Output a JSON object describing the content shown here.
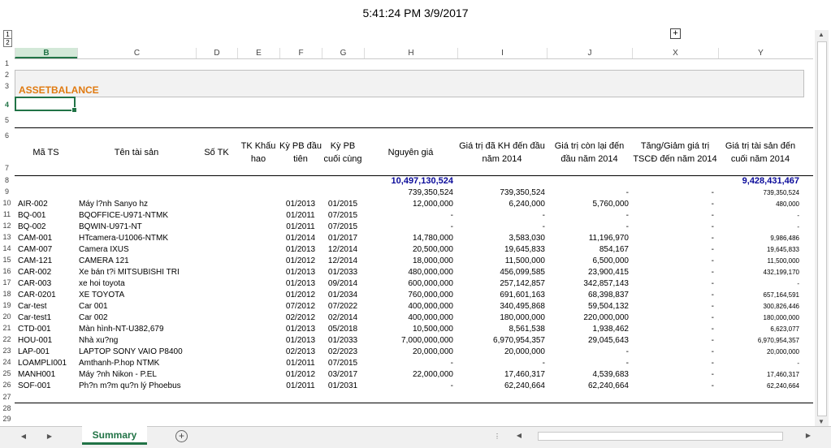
{
  "timestamp": "5:41:24 PM 3/9/2017",
  "outline": [
    "1",
    "2"
  ],
  "columns": [
    "B",
    "C",
    "D",
    "E",
    "F",
    "G",
    "H",
    "I",
    "J",
    "X",
    "Y"
  ],
  "rows": [
    "1",
    "2",
    "3",
    "4",
    "5",
    "6",
    "7",
    "8",
    "9",
    "10",
    "11",
    "12",
    "13",
    "14",
    "15",
    "16",
    "17",
    "18",
    "19",
    "20",
    "21",
    "22",
    "23",
    "24",
    "25",
    "26",
    "27",
    "28",
    "29"
  ],
  "title": "ASSETBALANCE",
  "headers": [
    "Mã TS",
    "Tên tài sản",
    "Số TK",
    "TK Khấu hao",
    "Kỳ PB đầu tiên",
    "Kỳ PB cuối cùng",
    "Nguyên giá",
    "Giá trị đã KH đến đầu năm 2014",
    "Giá trị còn lại đến đầu năm 2014",
    "Tăng/Giảm giá trị TSCĐ đến năm 2014",
    "Giá trị tài sản đến cuối năm 2014"
  ],
  "totals": {
    "nguyen_gia": "10,497,130,524",
    "cuoi_nam": "9,428,431,467"
  },
  "row9": {
    "nguyen_gia": "739,350,524",
    "da_kh": "739,350,524",
    "con_lai": "-",
    "tang_giam": "-",
    "cuoi_nam": "739,350,524"
  },
  "data": [
    {
      "ma": "AIR-002",
      "ten": "Máy l?nh Sanyo hz",
      "pb1": "01/2013",
      "pb2": "01/2015",
      "ng": "12,000,000",
      "kh": "6,240,000",
      "cl": "5,760,000",
      "tg": "-",
      "cn": "480,000"
    },
    {
      "ma": "BQ-001",
      "ten": "BQOFFICE-U971-NTMK",
      "pb1": "01/2011",
      "pb2": "07/2015",
      "ng": "-",
      "kh": "-",
      "cl": "-",
      "tg": "-",
      "cn": "-"
    },
    {
      "ma": "BQ-002",
      "ten": "BQWIN-U971-NT",
      "pb1": "01/2011",
      "pb2": "07/2015",
      "ng": "-",
      "kh": "-",
      "cl": "-",
      "tg": "-",
      "cn": "-"
    },
    {
      "ma": "CAM-001",
      "ten": "HTcamera-U1006-NTMK",
      "pb1": "01/2014",
      "pb2": "01/2017",
      "ng": "14,780,000",
      "kh": "3,583,030",
      "cl": "11,196,970",
      "tg": "-",
      "cn": "9,986,486"
    },
    {
      "ma": "CAM-007",
      "ten": "Camera IXUS",
      "pb1": "01/2013",
      "pb2": "12/2014",
      "ng": "20,500,000",
      "kh": "19,645,833",
      "cl": "854,167",
      "tg": "-",
      "cn": "19,645,833"
    },
    {
      "ma": "CAM-121",
      "ten": "CAMERA 121",
      "pb1": "01/2012",
      "pb2": "12/2014",
      "ng": "18,000,000",
      "kh": "11,500,000",
      "cl": "6,500,000",
      "tg": "-",
      "cn": "11,500,000"
    },
    {
      "ma": "CAR-002",
      "ten": "Xe bán t?i MITSUBISHI TRI",
      "pb1": "01/2013",
      "pb2": "01/2033",
      "ng": "480,000,000",
      "kh": "456,099,585",
      "cl": "23,900,415",
      "tg": "-",
      "cn": "432,199,170"
    },
    {
      "ma": "CAR-003",
      "ten": "xe hoi toyota",
      "pb1": "01/2013",
      "pb2": "09/2014",
      "ng": "600,000,000",
      "kh": "257,142,857",
      "cl": "342,857,143",
      "tg": "-",
      "cn": "-"
    },
    {
      "ma": "CAR-0201",
      "ten": "XE TOYOTA",
      "pb1": "01/2012",
      "pb2": "01/2034",
      "ng": "760,000,000",
      "kh": "691,601,163",
      "cl": "68,398,837",
      "tg": "-",
      "cn": "657,164,591"
    },
    {
      "ma": "Car-test",
      "ten": "Car 001",
      "pb1": "07/2012",
      "pb2": "07/2022",
      "ng": "400,000,000",
      "kh": "340,495,868",
      "cl": "59,504,132",
      "tg": "-",
      "cn": "300,826,446"
    },
    {
      "ma": "Car-test1",
      "ten": "Car 002",
      "pb1": "02/2012",
      "pb2": "02/2014",
      "ng": "400,000,000",
      "kh": "180,000,000",
      "cl": "220,000,000",
      "tg": "-",
      "cn": "180,000,000"
    },
    {
      "ma": "CTD-001",
      "ten": "Màn hình-NT-U382,679",
      "pb1": "01/2013",
      "pb2": "05/2018",
      "ng": "10,500,000",
      "kh": "8,561,538",
      "cl": "1,938,462",
      "tg": "-",
      "cn": "6,623,077"
    },
    {
      "ma": "HOU-001",
      "ten": "Nhà xu?ng",
      "pb1": "01/2013",
      "pb2": "01/2033",
      "ng": "7,000,000,000",
      "kh": "6,970,954,357",
      "cl": "29,045,643",
      "tg": "-",
      "cn": "6,970,954,357"
    },
    {
      "ma": "LAP-001",
      "ten": "LAPTOP SONY VAIO P8400",
      "pb1": "02/2013",
      "pb2": "02/2023",
      "ng": "20,000,000",
      "kh": "20,000,000",
      "cl": "-",
      "tg": "-",
      "cn": "20,000,000"
    },
    {
      "ma": "LOAMPLI001",
      "ten": "Amthanh-P.hop NTMK",
      "pb1": "01/2011",
      "pb2": "07/2015",
      "ng": "-",
      "kh": "-",
      "cl": "-",
      "tg": "-",
      "cn": "-"
    },
    {
      "ma": "MANH001",
      "ten": "Máy ?nh Nikon - P.EL",
      "pb1": "01/2012",
      "pb2": "03/2017",
      "ng": "22,000,000",
      "kh": "17,460,317",
      "cl": "4,539,683",
      "tg": "-",
      "cn": "17,460,317"
    },
    {
      "ma": "SOF-001",
      "ten": "Ph?n m?m qu?n lý Phoebus",
      "pb1": "01/2011",
      "pb2": "01/2031",
      "ng": "-",
      "kh": "62,240,664",
      "cl": "62,240,664",
      "tg": "-",
      "cn": "62,240,664"
    }
  ],
  "sheet_tab": "Summary",
  "add_sheet": "+",
  "expand_icon": "+"
}
